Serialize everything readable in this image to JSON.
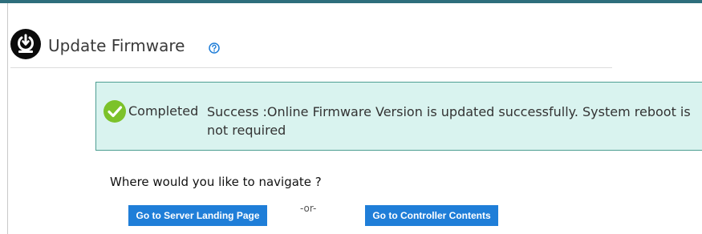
{
  "header": {
    "title": "Update Firmware",
    "icon": "firmware-update-icon",
    "help_icon": "help-circle-icon"
  },
  "status": {
    "icon": "check-circle-icon",
    "label": "Completed",
    "message": "Success :Online Firmware Version is updated successfully. System reboot is not required",
    "background_color": "#d9f3ef",
    "border_color": "#4e9e92",
    "check_color": "#7cc22a"
  },
  "navigation": {
    "question": "Where would you like to navigate ?",
    "server_button_label": "Go to Server Landing Page",
    "separator": "-or-",
    "controller_button_label": "Go to Controller Contents"
  },
  "colors": {
    "accent": "#2e6e7c",
    "button": "#1f7ed8"
  }
}
